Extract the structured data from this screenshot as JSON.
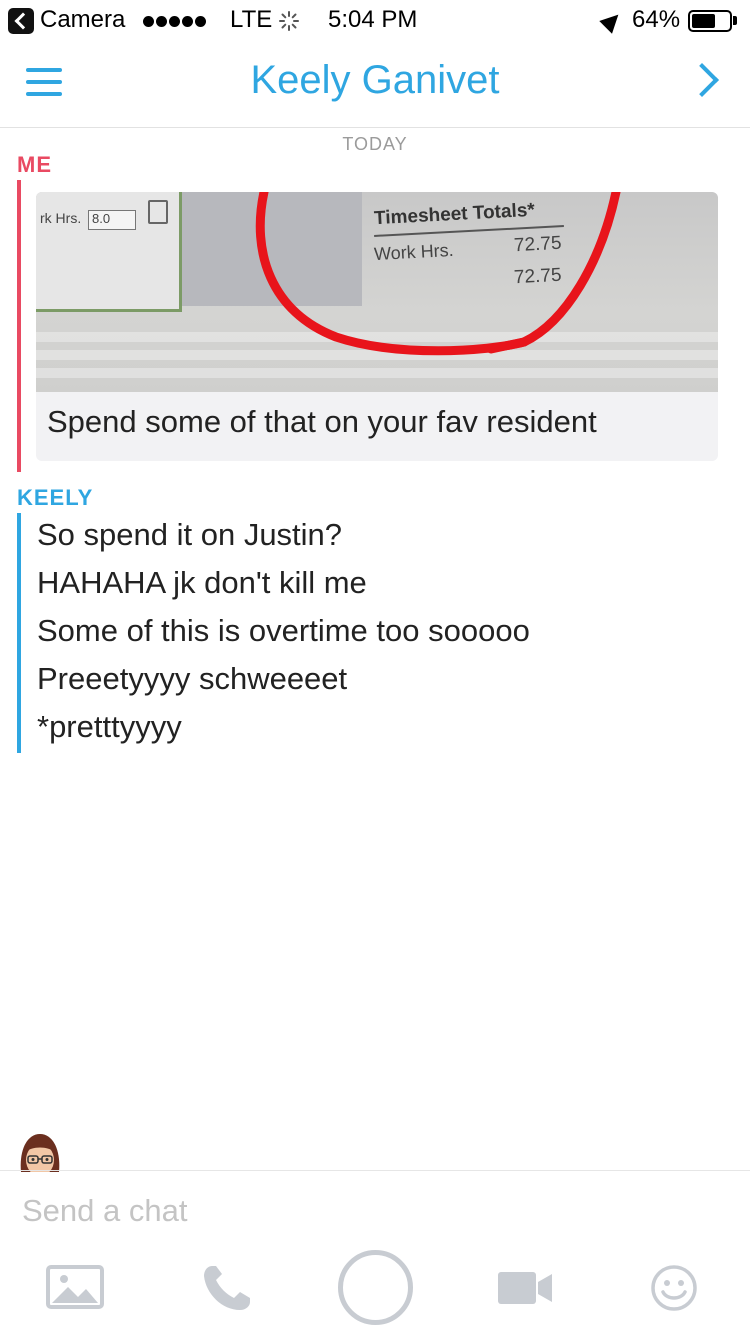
{
  "status_bar": {
    "back_app": "Camera",
    "carrier": "LTE",
    "time": "5:04 PM",
    "battery": "64%",
    "battery_level": 0.64,
    "signal_dots": 5
  },
  "header": {
    "menu_icon": "hamburger-icon",
    "title": "Keely Ganivet",
    "forward_icon": "chevron-right-icon"
  },
  "conversation": {
    "date_divider": "TODAY",
    "me": {
      "sender": "ME",
      "photo": {
        "field_label": "rk Hrs.",
        "field_value": "8.0",
        "totals_heading": "Timesheet Totals*",
        "work_label": "Work Hrs.",
        "value_1": "72.75",
        "value_2": "72.75"
      },
      "caption": "Spend some of that on your fav resident"
    },
    "keely": {
      "sender": "KEELY",
      "messages": [
        " So spend it on Justin?",
        "HAHAHA jk don't kill me",
        "Some of this is overtime too sooooo",
        "Preeetyyyy schweeeet",
        "*pretttyyyy"
      ]
    }
  },
  "composer": {
    "placeholder": "Send a chat",
    "tools": [
      "image-icon",
      "phone-icon",
      "capture-button",
      "video-icon",
      "emoji-icon"
    ]
  },
  "colors": {
    "accent_blue": "#2fa6e1",
    "me_red": "#e94a62",
    "toolbar_gray": "#c8ccd2"
  }
}
